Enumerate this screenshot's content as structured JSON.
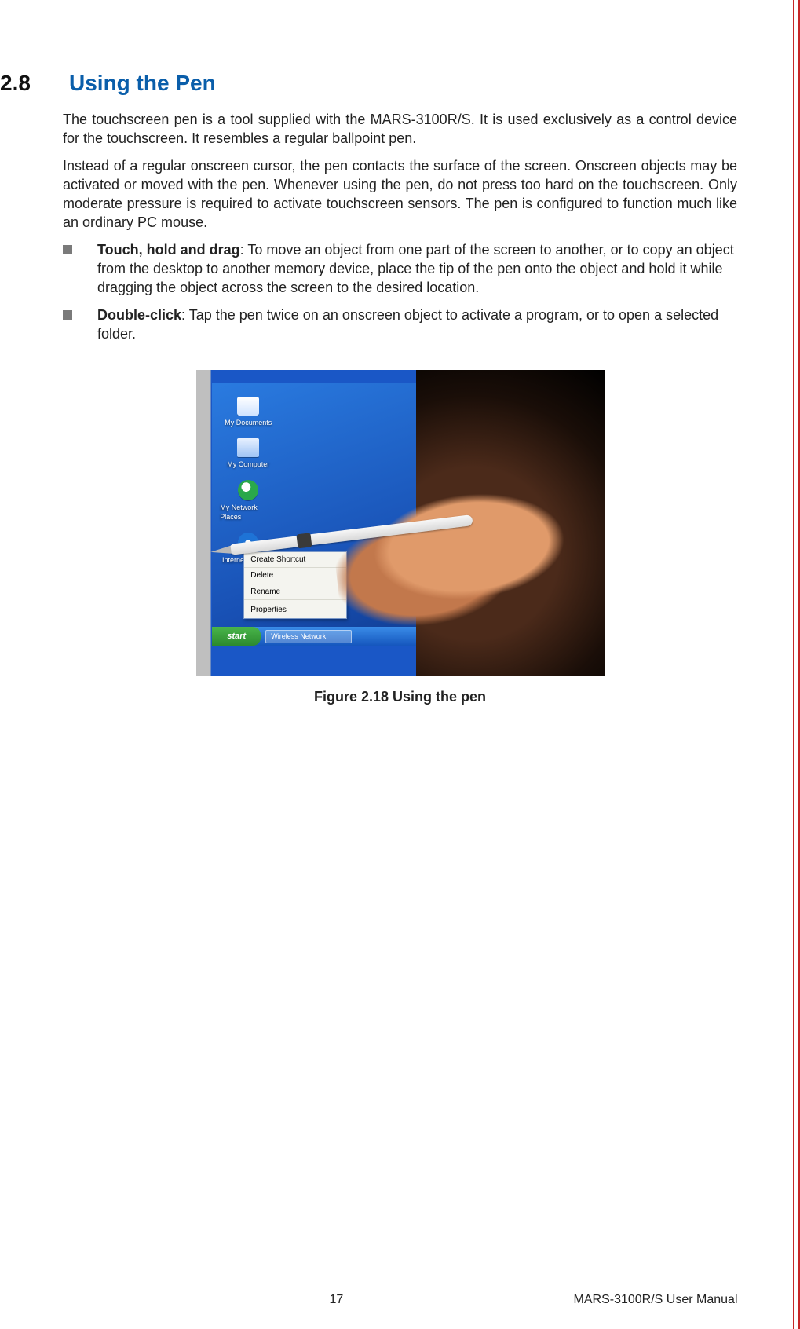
{
  "section": {
    "number": "2.8",
    "title": "Using the Pen"
  },
  "paragraphs": {
    "p1": "The touchscreen pen is a tool supplied with the MARS-3100R/S. It is used exclusively as a control device for the touchscreen. It resembles a regular ballpoint pen.",
    "p2": "Instead of a regular onscreen cursor, the pen contacts the surface of the screen. Onscreen objects may be activated or moved with the pen. Whenever using the pen, do not press too hard on the touchscreen. Only moderate pressure is required to activate touchscreen sensors. The pen is configured to function much like an ordinary PC mouse."
  },
  "bullets": [
    {
      "lead": "Touch, hold and drag",
      "text": ": To move an object from one part of the screen to another, or to copy an object from the desktop to another memory device, place the tip of the pen onto the object and hold it while dragging the object across the screen to the desired location."
    },
    {
      "lead": "Double-click",
      "text": ": Tap the pen twice on an onscreen object to activate a program, or to open a selected folder."
    }
  ],
  "figure": {
    "caption": "Figure 2.18 Using the pen",
    "desktop_icons": [
      "My Documents",
      "My Computer",
      "My Network Places",
      "Internet Explorer"
    ],
    "context_menu": [
      "Create Shortcut",
      "Delete",
      "Rename",
      "Properties"
    ],
    "start_label": "start",
    "task_tile": "Wireless Network"
  },
  "footer": {
    "page": "17",
    "doc": "MARS-3100R/S User Manual"
  }
}
